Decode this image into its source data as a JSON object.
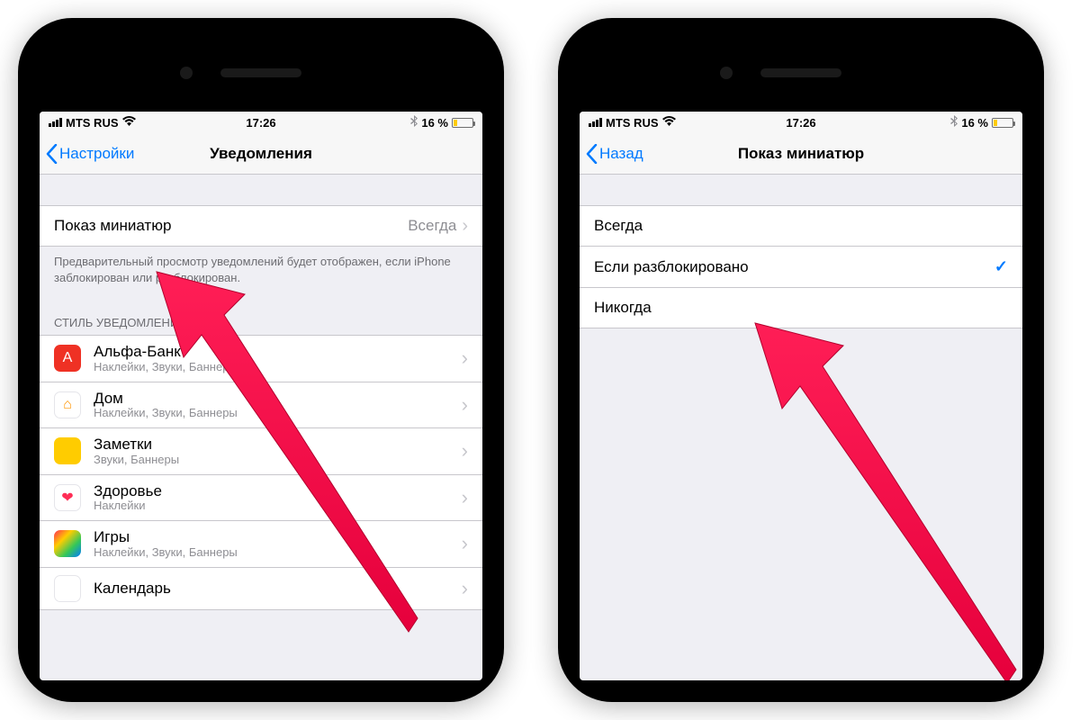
{
  "statusbar": {
    "carrier": "MTS RUS",
    "time": "17:26",
    "battery_pct": "16 %"
  },
  "phone1": {
    "nav": {
      "back": "Настройки",
      "title": "Уведомления"
    },
    "preview_row": {
      "label": "Показ миниатюр",
      "value": "Всегда"
    },
    "footer_note": "Предварительный просмотр уведомлений будет отображен, если iPhone заблокирован или разблокирован.",
    "section_header": "СТИЛЬ УВЕДОМЛЕНИЙ",
    "apps": [
      {
        "name": "Альфа-Банк",
        "sub": "Наклейки, Звуки, Баннеры",
        "icon_bg": "#ef3124",
        "icon_char": "A",
        "icon_color": "#fff"
      },
      {
        "name": "Дом",
        "sub": "Наклейки, Звуки, Баннеры",
        "icon_bg": "#ffffff",
        "icon_char": "⌂",
        "icon_color": "#ff9500"
      },
      {
        "name": "Заметки",
        "sub": "Звуки, Баннеры",
        "icon_bg": "#ffcc00",
        "icon_char": "",
        "icon_color": "#fff"
      },
      {
        "name": "Здоровье",
        "sub": "Наклейки",
        "icon_bg": "#ffffff",
        "icon_char": "❤",
        "icon_color": "#ff2d55"
      },
      {
        "name": "Игры",
        "sub": "Наклейки, Звуки, Баннеры",
        "icon_bg": "linear-gradient(135deg,#ff2d55,#ffcc00,#34c759,#007aff)",
        "icon_char": "",
        "icon_color": "#fff"
      },
      {
        "name": "Календарь",
        "sub": "",
        "icon_bg": "#ffffff",
        "icon_char": "",
        "icon_color": "#ff3b30"
      }
    ]
  },
  "phone2": {
    "nav": {
      "back": "Назад",
      "title": "Показ миниатюр"
    },
    "options": [
      {
        "label": "Всегда",
        "selected": false
      },
      {
        "label": "Если разблокировано",
        "selected": true
      },
      {
        "label": "Никогда",
        "selected": false
      }
    ]
  }
}
